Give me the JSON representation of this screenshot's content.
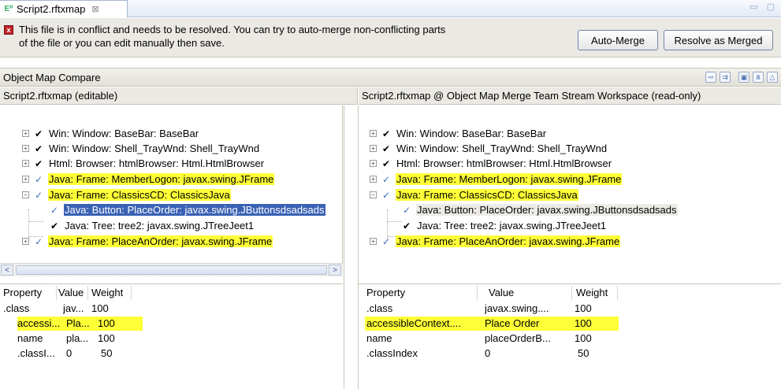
{
  "editor_tab": {
    "icon": "E⁰",
    "title": "Script2.rftxmap",
    "close": "⊠"
  },
  "window_controls": "▭ ▢",
  "banner": {
    "icon": "x",
    "message_line1": "This file is in conflict and needs to be resolved. You can try to auto-merge non-conflicting parts",
    "message_line2": "of the file or you can edit manually then save.",
    "auto_merge_label": "Auto-Merge",
    "resolve_label": "Resolve as Merged"
  },
  "section": {
    "title": "Object Map Compare",
    "tool_icons": [
      "copy-right-icon",
      "copy-all-icon",
      "save-icon",
      "merge-icon",
      "next-change-icon"
    ]
  },
  "left_pane": {
    "header": "Script2.rftxmap  (editable)"
  },
  "right_pane": {
    "header": "Script2.rftxmap @ Object Map Merge Team Stream Workspace (read-only)"
  },
  "tree_left": [
    {
      "text": "Win: Window: BaseBar: BaseBar",
      "expander": "+",
      "check": "✔",
      "style": "normal"
    },
    {
      "text": "Win: Window: Shell_TrayWnd: Shell_TrayWnd",
      "expander": "+",
      "check": "✔",
      "style": "normal"
    },
    {
      "text": "Html: Browser: htmlBrowser: Html.HtmlBrowser",
      "expander": "+",
      "check": "✔",
      "style": "normal"
    },
    {
      "text": "Java: Frame: MemberLogon: javax.swing.JFrame",
      "expander": "+",
      "check": "✓",
      "style": "hl"
    },
    {
      "text": "Java: Frame: ClassicsCD: ClassicsJava",
      "expander": "−",
      "check": "✓",
      "style": "hl"
    },
    {
      "text": "Java: Button: PlaceOrder: javax.swing.JButtonsdsadsads",
      "expander": "",
      "check": "✓",
      "style": "sel"
    },
    {
      "text": "Java: Tree: tree2: javax.swing.JTreeJeet1",
      "expander": "",
      "check": "✔",
      "style": "normal"
    },
    {
      "text": "Java: Frame: PlaceAnOrder: javax.swing.JFrame",
      "expander": "+",
      "check": "✓",
      "style": "hl"
    }
  ],
  "tree_right": [
    {
      "text": "Win: Window: BaseBar: BaseBar",
      "expander": "+",
      "check": "✔",
      "style": "normal"
    },
    {
      "text": "Win: Window: Shell_TrayWnd: Shell_TrayWnd",
      "expander": "+",
      "check": "✔",
      "style": "normal"
    },
    {
      "text": "Html: Browser: htmlBrowser: Html.HtmlBrowser",
      "expander": "+",
      "check": "✔",
      "style": "normal"
    },
    {
      "text": "Java: Frame: MemberLogon: javax.swing.JFrame",
      "expander": "+",
      "check": "✓",
      "style": "hl"
    },
    {
      "text": "Java: Frame: ClassicsCD: ClassicsJava",
      "expander": "−",
      "check": "✓",
      "style": "hl"
    },
    {
      "text": "Java: Button: PlaceOrder: javax.swing.JButtonsdsadsads",
      "expander": "",
      "check": "✓",
      "style": "grey"
    },
    {
      "text": "Java: Tree: tree2: javax.swing.JTreeJeet1",
      "expander": "",
      "check": "✔",
      "style": "normal"
    },
    {
      "text": "Java: Frame: PlaceAnOrder: javax.swing.JFrame",
      "expander": "+",
      "check": "✓",
      "style": "hl"
    }
  ],
  "scrollbar": {
    "left_arrow": "<",
    "right_arrow": ">"
  },
  "props_left": {
    "columns": [
      "Property",
      "Value",
      "Weight"
    ],
    "rows": [
      {
        "property": ".class",
        "value": "jav...",
        "weight": "100",
        "hl": false
      },
      {
        "property": "accessi...",
        "value": "Pla...",
        "weight": "100",
        "hl": true
      },
      {
        "property": "name",
        "value": "pla...",
        "weight": "100",
        "hl": false
      },
      {
        "property": ".classI...",
        "value": "0",
        "weight": "50",
        "hl": false
      }
    ]
  },
  "props_right": {
    "columns": [
      "Property",
      "Value",
      "Weight"
    ],
    "rows": [
      {
        "property": ".class",
        "value": "javax.swing....",
        "weight": "100",
        "hl": false
      },
      {
        "property": "accessibleContext....",
        "value": "Place Order",
        "weight": "100",
        "hl": true
      },
      {
        "property": "name",
        "value": "placeOrderB...",
        "weight": "100",
        "hl": false
      },
      {
        "property": ".classIndex",
        "value": "0",
        "weight": "50",
        "hl": false
      }
    ]
  }
}
